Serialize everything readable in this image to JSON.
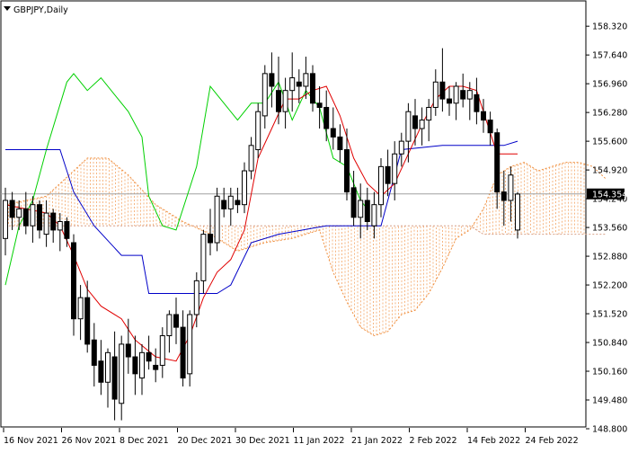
{
  "header": {
    "symbol_label": "GBPJPY,Daily",
    "dropdown_icon": "triangle-down-icon"
  },
  "price_badge": {
    "value": "154.354"
  },
  "colors": {
    "bull": "#ffffff",
    "bear": "#000000",
    "tenkan": "#e00000",
    "kijun": "#0000c8",
    "chikou": "#00d000",
    "cloud": "#f09040",
    "cloud_b": "#d8a088",
    "grid": "#c0c0c0",
    "current_line": "#a0a0a0"
  },
  "chart_data": {
    "type": "candlestick",
    "title": "GBPJPY,Daily",
    "ylim": [
      148.8,
      158.6
    ],
    "y_ticks": [
      "158.320",
      "157.640",
      "156.960",
      "156.280",
      "155.600",
      "154.920",
      "154.240",
      "153.560",
      "152.880",
      "152.200",
      "151.520",
      "150.840",
      "150.160",
      "149.480",
      "148.800"
    ],
    "x_ticks": [
      "16 Nov 2021",
      "26 Nov 2021",
      "8 Dec 2021",
      "20 Dec 2021",
      "30 Dec 2021",
      "11 Jan 2022",
      "21 Jan 2022",
      "2 Feb 2022",
      "14 Feb 2022",
      "24 Feb 2022"
    ],
    "current_price": 154.354,
    "candles": [
      [
        153.3,
        154.5,
        152.9,
        154.2
      ],
      [
        154.2,
        154.4,
        153.5,
        153.8
      ],
      [
        153.8,
        154.2,
        153.5,
        154.0
      ],
      [
        154.0,
        154.4,
        153.4,
        153.6
      ],
      [
        153.6,
        154.3,
        153.2,
        154.1
      ],
      [
        154.1,
        154.2,
        153.3,
        153.5
      ],
      [
        153.4,
        154.2,
        153.1,
        153.9
      ],
      [
        153.9,
        154.0,
        153.2,
        153.5
      ],
      [
        153.5,
        153.9,
        153.0,
        153.7
      ],
      [
        153.7,
        153.8,
        153.1,
        153.3
      ],
      [
        153.2,
        153.4,
        151.0,
        151.4
      ],
      [
        151.4,
        152.2,
        150.9,
        151.9
      ],
      [
        151.9,
        152.3,
        150.6,
        150.8
      ],
      [
        150.9,
        151.3,
        149.8,
        150.3
      ],
      [
        150.4,
        150.9,
        149.6,
        149.9
      ],
      [
        149.9,
        150.7,
        149.3,
        150.6
      ],
      [
        150.5,
        151.1,
        149.0,
        149.5
      ],
      [
        149.4,
        151.0,
        149.0,
        150.8
      ],
      [
        150.8,
        151.4,
        150.1,
        150.5
      ],
      [
        150.5,
        151.0,
        149.6,
        150.1
      ],
      [
        150.0,
        150.8,
        149.6,
        150.6
      ],
      [
        150.6,
        151.0,
        150.2,
        150.4
      ],
      [
        150.3,
        150.7,
        149.9,
        150.2
      ],
      [
        150.3,
        151.2,
        150.0,
        151.0
      ],
      [
        151.0,
        151.6,
        150.6,
        151.5
      ],
      [
        151.5,
        151.9,
        150.8,
        151.2
      ],
      [
        151.2,
        151.6,
        149.8,
        150.0
      ],
      [
        150.1,
        151.6,
        149.8,
        151.5
      ],
      [
        151.5,
        152.5,
        151.2,
        152.3
      ],
      [
        152.3,
        153.5,
        152.0,
        153.4
      ],
      [
        153.4,
        154.0,
        152.9,
        153.2
      ],
      [
        153.2,
        154.5,
        153.0,
        154.3
      ],
      [
        154.2,
        154.5,
        153.8,
        154.0
      ],
      [
        154.0,
        154.5,
        153.6,
        154.3
      ],
      [
        154.2,
        154.5,
        153.9,
        154.1
      ],
      [
        154.1,
        155.1,
        153.9,
        154.9
      ],
      [
        154.9,
        155.7,
        154.7,
        155.5
      ],
      [
        155.4,
        156.5,
        155.2,
        156.3
      ],
      [
        156.2,
        157.4,
        155.9,
        157.2
      ],
      [
        157.2,
        157.7,
        156.4,
        156.9
      ],
      [
        156.8,
        157.6,
        156.0,
        156.3
      ],
      [
        156.3,
        157.1,
        155.9,
        156.8
      ],
      [
        156.8,
        157.7,
        156.3,
        157.1
      ],
      [
        157.0,
        157.3,
        156.5,
        156.9
      ],
      [
        156.9,
        157.6,
        156.6,
        157.2
      ],
      [
        157.2,
        157.4,
        156.3,
        156.5
      ],
      [
        156.5,
        156.9,
        155.9,
        156.4
      ],
      [
        156.4,
        156.8,
        155.6,
        155.9
      ],
      [
        155.9,
        156.4,
        155.4,
        155.7
      ],
      [
        155.7,
        156.0,
        155.1,
        155.4
      ],
      [
        155.4,
        155.9,
        154.2,
        154.4
      ],
      [
        154.5,
        154.9,
        153.6,
        153.8
      ],
      [
        153.8,
        154.6,
        153.3,
        154.2
      ],
      [
        154.2,
        154.5,
        153.5,
        153.7
      ],
      [
        153.6,
        154.4,
        153.3,
        154.1
      ],
      [
        154.1,
        155.2,
        153.8,
        155.0
      ],
      [
        155.0,
        155.4,
        154.3,
        154.6
      ],
      [
        154.6,
        155.6,
        154.2,
        155.3
      ],
      [
        155.3,
        155.8,
        155.0,
        155.6
      ],
      [
        155.6,
        156.5,
        155.1,
        156.3
      ],
      [
        156.2,
        156.6,
        155.5,
        155.9
      ],
      [
        155.9,
        156.4,
        155.5,
        156.1
      ],
      [
        156.1,
        156.6,
        155.6,
        156.4
      ],
      [
        156.4,
        157.3,
        156.2,
        157.0
      ],
      [
        157.0,
        157.8,
        156.3,
        156.6
      ],
      [
        156.6,
        156.9,
        156.2,
        156.5
      ],
      [
        156.5,
        157.0,
        156.1,
        156.9
      ],
      [
        156.8,
        157.2,
        156.4,
        156.6
      ],
      [
        156.6,
        157.0,
        156.1,
        156.8
      ],
      [
        156.7,
        157.1,
        156.0,
        156.3
      ],
      [
        156.3,
        156.6,
        155.8,
        156.1
      ],
      [
        156.1,
        156.3,
        155.5,
        155.8
      ],
      [
        155.8,
        155.9,
        154.0,
        154.4
      ],
      [
        154.4,
        154.9,
        153.6,
        154.2
      ],
      [
        154.2,
        155.0,
        153.7,
        154.8
      ],
      [
        153.5,
        154.4,
        153.3,
        154.35
      ]
    ],
    "tenkan": [
      [
        0,
        154.1
      ],
      [
        3,
        154.0
      ],
      [
        6,
        153.9
      ],
      [
        8,
        153.6
      ],
      [
        10,
        152.9
      ],
      [
        12,
        152.1
      ],
      [
        14,
        151.7
      ],
      [
        17,
        151.4
      ],
      [
        19,
        150.9
      ],
      [
        22,
        150.5
      ],
      [
        25,
        150.4
      ],
      [
        27,
        151.0
      ],
      [
        29,
        151.9
      ],
      [
        31,
        152.5
      ],
      [
        33,
        152.8
      ],
      [
        35,
        153.5
      ],
      [
        37,
        155.2
      ],
      [
        39,
        155.9
      ],
      [
        41,
        156.6
      ],
      [
        43,
        156.6
      ],
      [
        45,
        156.8
      ],
      [
        47,
        156.9
      ],
      [
        49,
        156.2
      ],
      [
        51,
        155.2
      ],
      [
        53,
        154.6
      ],
      [
        55,
        154.3
      ],
      [
        57,
        154.6
      ],
      [
        59,
        155.3
      ],
      [
        61,
        156.0
      ],
      [
        63,
        156.6
      ],
      [
        65,
        156.9
      ],
      [
        67,
        156.9
      ],
      [
        69,
        156.8
      ],
      [
        71,
        155.8
      ],
      [
        72,
        155.3
      ],
      [
        75,
        155.3
      ]
    ],
    "kijun": [
      [
        0,
        155.4
      ],
      [
        8,
        155.4
      ],
      [
        10,
        154.4
      ],
      [
        13,
        153.6
      ],
      [
        17,
        152.9
      ],
      [
        20,
        152.9
      ],
      [
        21,
        152.0
      ],
      [
        31,
        152.0
      ],
      [
        33,
        152.2
      ],
      [
        36,
        153.2
      ],
      [
        40,
        153.4
      ],
      [
        47,
        153.6
      ],
      [
        55,
        153.6
      ],
      [
        58,
        155.4
      ],
      [
        64,
        155.5
      ],
      [
        73,
        155.5
      ],
      [
        75,
        155.6
      ]
    ],
    "chikou": [
      [
        0,
        152.2
      ],
      [
        2,
        153.6
      ],
      [
        4,
        154.2
      ],
      [
        6,
        155.4
      ],
      [
        9,
        157.0
      ],
      [
        10,
        157.2
      ],
      [
        12,
        156.8
      ],
      [
        14,
        157.1
      ],
      [
        16,
        156.7
      ],
      [
        18,
        156.3
      ],
      [
        20,
        155.7
      ],
      [
        21,
        154.3
      ],
      [
        23,
        153.6
      ],
      [
        25,
        153.5
      ],
      [
        28,
        155.0
      ],
      [
        30,
        156.9
      ],
      [
        32,
        156.5
      ],
      [
        34,
        156.1
      ],
      [
        36,
        156.5
      ],
      [
        38,
        156.5
      ],
      [
        40,
        157.0
      ],
      [
        42,
        156.1
      ],
      [
        44,
        156.8
      ],
      [
        46,
        156.4
      ],
      [
        48,
        155.2
      ],
      [
        50,
        155.0
      ],
      [
        52,
        154.2
      ],
      [
        53,
        154.0
      ]
    ],
    "cloud_a": [
      [
        0,
        154.1
      ],
      [
        6,
        154.3
      ],
      [
        12,
        155.2
      ],
      [
        15,
        155.2
      ],
      [
        18,
        154.8
      ],
      [
        22,
        154.1
      ],
      [
        26,
        153.7
      ],
      [
        30,
        153.4
      ],
      [
        34,
        153.0
      ],
      [
        38,
        153.2
      ],
      [
        42,
        153.3
      ],
      [
        46,
        153.5
      ],
      [
        48,
        152.5
      ],
      [
        50,
        151.8
      ],
      [
        52,
        151.2
      ],
      [
        54,
        151.0
      ],
      [
        56,
        151.1
      ],
      [
        58,
        151.5
      ],
      [
        60,
        151.6
      ],
      [
        62,
        152.0
      ],
      [
        64,
        152.6
      ],
      [
        66,
        153.3
      ],
      [
        68,
        153.5
      ],
      [
        70,
        154.0
      ],
      [
        72,
        154.8
      ],
      [
        74,
        155.0
      ],
      [
        76,
        155.1
      ],
      [
        78,
        154.9
      ],
      [
        80,
        155.0
      ],
      [
        82,
        155.1
      ],
      [
        84,
        155.1
      ],
      [
        86,
        155.0
      ],
      [
        88,
        154.7
      ]
    ],
    "cloud_b": [
      [
        0,
        153.6
      ],
      [
        10,
        153.6
      ],
      [
        20,
        153.6
      ],
      [
        30,
        153.6
      ],
      [
        40,
        153.6
      ],
      [
        50,
        153.6
      ],
      [
        60,
        153.6
      ],
      [
        68,
        153.6
      ],
      [
        70,
        153.4
      ],
      [
        80,
        153.4
      ],
      [
        88,
        153.4
      ]
    ]
  }
}
